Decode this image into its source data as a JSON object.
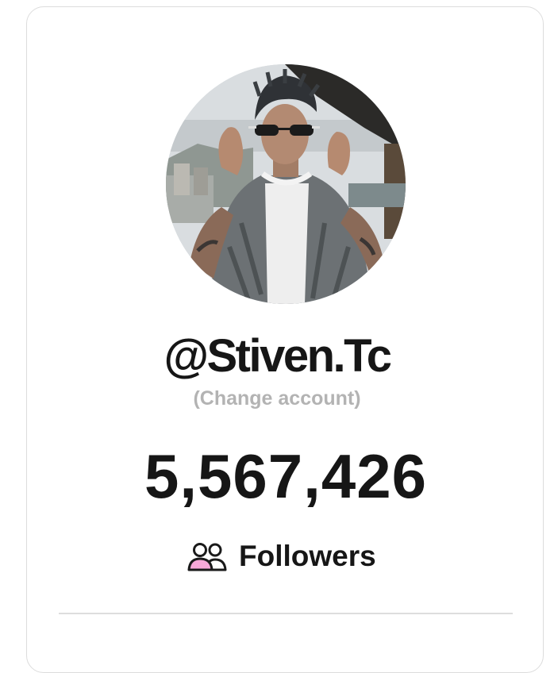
{
  "profile": {
    "username": "@Stiven.Tc",
    "change_account_label": "(Change account)",
    "follower_count": "5,567,426",
    "followers_label": "Followers",
    "followers_icon": "people-icon",
    "accent_color": "#f7a8d8"
  }
}
